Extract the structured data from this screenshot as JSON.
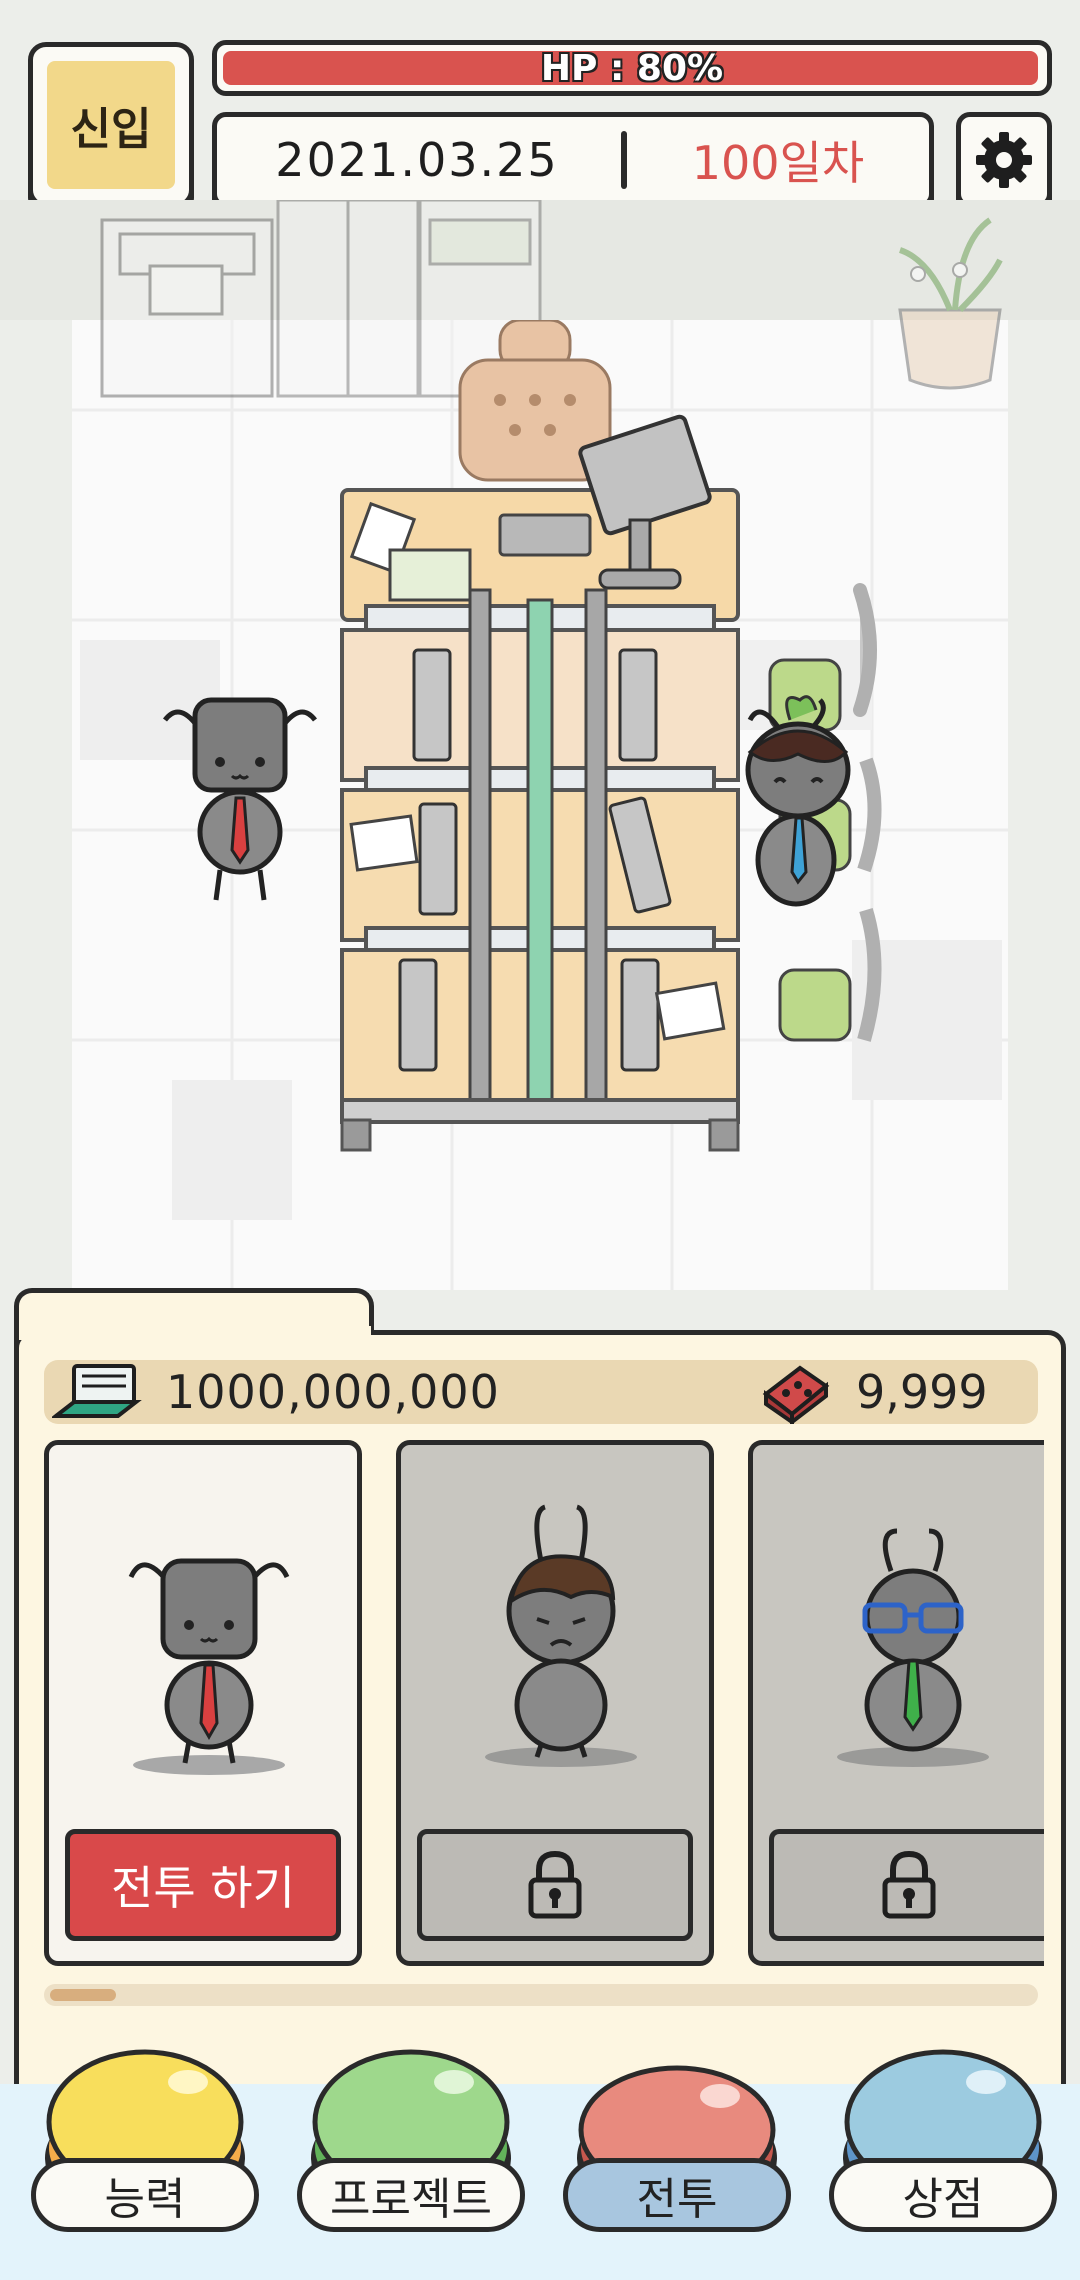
{
  "hud": {
    "rank": "신입",
    "hp_label": "HP : 80%",
    "hp_percent": 80,
    "date": "2021.03.25",
    "day": "100일차",
    "settings_icon": "gear-icon"
  },
  "currency": {
    "money_icon": "laptop-icon",
    "money": "1000,000,000",
    "brick_icon": "brick-icon",
    "bricks": "9,999"
  },
  "cards": [
    {
      "character": "black-ant-red-tie",
      "state": "unlocked",
      "button_label": "전투 하기"
    },
    {
      "character": "brown-hair-ant",
      "state": "locked",
      "button_icon": "lock-icon"
    },
    {
      "character": "glasses-ant-green-tie",
      "state": "locked",
      "button_icon": "lock-icon"
    }
  ],
  "nav": [
    {
      "label": "능력",
      "color": "#f8de5c",
      "active": false
    },
    {
      "label": "프로젝트",
      "color": "#9ed88c",
      "active": false
    },
    {
      "label": "전투",
      "color": "#e88a7e",
      "active": true
    },
    {
      "label": "상점",
      "color": "#9ccbe0",
      "active": false
    }
  ],
  "colors": {
    "hp_red": "#d9534f",
    "day_red": "#d9534f",
    "battle_button": "#d9494a",
    "rank_yellow": "#f2d88a"
  }
}
